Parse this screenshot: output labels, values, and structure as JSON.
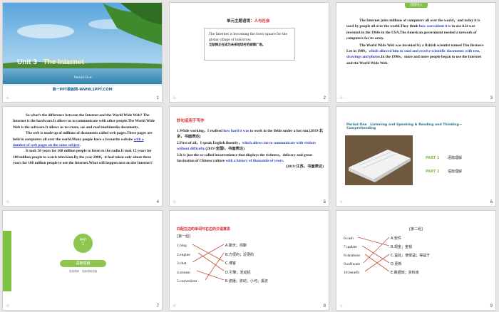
{
  "slide1": {
    "unit": "Unit 3",
    "title": "The Internet",
    "subtitle": "Period One",
    "footer": "第一PPT模板网-WWW.1PPT.COM",
    "num": "1"
  },
  "slide2": {
    "heading_prefix": "单元主题语境：",
    "heading_topic": "人与社会",
    "quote_en_1": "The Internet is becoming the town square for the",
    "quote_en_2": "global village of tomorrow.",
    "quote_cn": "互联网正在成为未来地球村的城镇广场。",
    "num": "2"
  },
  "slide3": {
    "tab": "话题导入",
    "p1_a": "The Internet joins millions of computers all over the world，and today it is used by people all over the world.They think ",
    "p1_hl": "how convenient it is",
    "p1_b": " to use it.It was invented in the 1960s in the USA.The American government needed a network of computers for its army.",
    "p2_a": "The World Wide Web was invented by a British scientist named Tim Berners-Lee in 1989，",
    "p2_hl": "which allowed him to send and receive scientific documents with text, drawings and photos",
    "p2_b": ".In the 1990s，more and more people began to use the Internet and the World Wide Web.",
    "num": "3"
  },
  "slide4": {
    "p1": "So what’s the difference between the Internet and the World Wide Web? The Internet is the hardware.It allows us to communicate with other people.The World Wide Web is the software.It allows us to create, see and read multimedia documents.",
    "p2_a": "The web is made up of millions of documents called web pages.These pages are held in computers all over the world.Many people have a favourite website ",
    "p2_hl": "with a number of web pages on the same subject",
    "p2_b": ".",
    "p3": "It took 50 years for 100 million people to listen to the radio.It took 15 years for 100 million people to watch television.By the year 2000，it had taken only about three years for 100 million people to use the Internet.What will happen next on the Internet?",
    "num": "4"
  },
  "slide5": {
    "heading": "妙句运用于写作",
    "s1_a": "1.While working，I realised ",
    "s1_hl": "how hard it was",
    "s1_b": " to work in the fields under a hot sun.(2019·北京，书面表达)",
    "s2_a": "2.First of all，I speak English fluently，",
    "s2_hl": "which allows me to communicate with visitors without difficulty",
    "s2_b": ".(2019·全国Ⅰ，书面表达)",
    "s3_a": "3.It is just the so-called inconvenience that displays the richness，delicacy and great fascination of Chinese culture ",
    "s3_hl": "with a history of thousands of years",
    "s3_b": ".",
    "s3_src": "(2019·江苏，书面表达)",
    "num": "5"
  },
  "slide6": {
    "period": "Period One　Listening and Speaking & Reading and Thinking—Comprehending",
    "part1": "PART 1",
    "part1_label": "语篇理解",
    "part2": "PART 2",
    "part2_label": "语篇理解",
    "num": "6"
  },
  "slide7": {
    "part": "PART",
    "part_num": "1",
    "label": "语篇理解",
    "sub": "语篇理解　语篇理解语篇",
    "num": "7"
  },
  "slide8": {
    "heading": "匹配左边的单词与右边的汉语意思",
    "group": "[第一组]",
    "left": [
      "1.blog",
      "2.engine",
      "3.chat",
      "4.stream",
      "5.convenient"
    ],
    "right": [
      "A.聊天；闲聊",
      "B.方便的；近便的",
      "C.博客",
      "D.引擎；发动机",
      "E.流播；流动；小河；溪流"
    ],
    "num": "8"
  },
  "slide9": {
    "group": "[第二组]",
    "left": [
      "6.cash",
      "7.update",
      "8.database",
      "9.software",
      "10.benefit"
    ],
    "right": [
      "A.软件",
      "B.现金；金钱",
      "C.益处；使受益；得益于",
      "D.更新",
      "E.数据库；资料库"
    ],
    "num": "9"
  },
  "colors": {
    "green": "#7ec041",
    "red": "#d9272e",
    "blue": "#2c3cc4",
    "teal": "#1f9bb5",
    "line": "#c0523a"
  }
}
